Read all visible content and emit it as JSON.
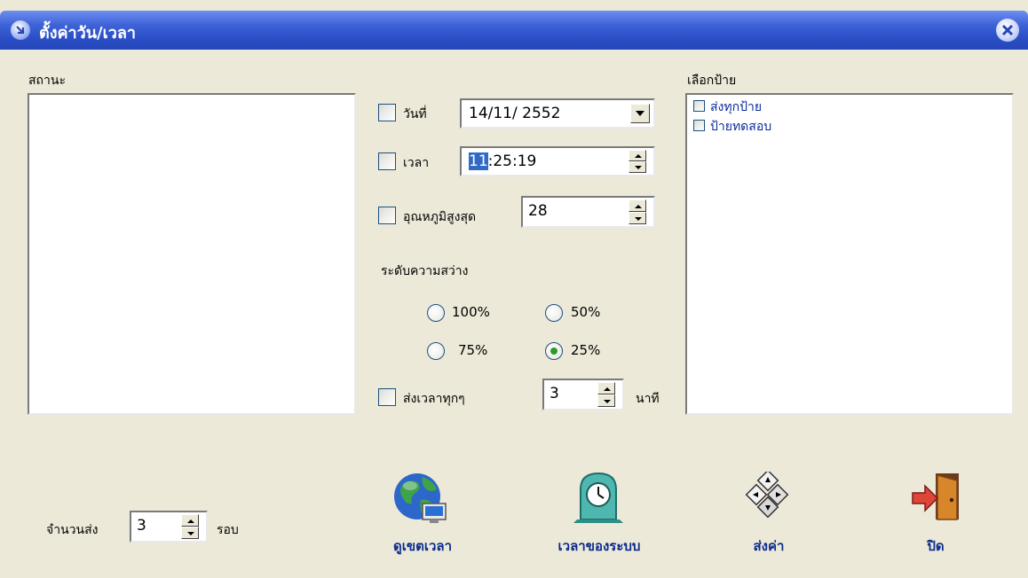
{
  "window": {
    "title": "ตั้งค่าวัน/เวลา"
  },
  "status": {
    "label": "สถานะ"
  },
  "date": {
    "label": "วันที่",
    "value": "14/11/ 2552"
  },
  "time": {
    "label": "เวลา",
    "value_highlight": "11",
    "value_rest": ":25:19"
  },
  "max_temp": {
    "label": "อุณหภูมิสูงสุด",
    "value": "28"
  },
  "brightness": {
    "label": "ระดับความสว่าง",
    "options": [
      "100%",
      "50%",
      "75%",
      "25%"
    ],
    "selected": "25%"
  },
  "send_time": {
    "label": "ส่งเวลาทุกๆ",
    "value": "3",
    "unit": "นาที"
  },
  "sign_select": {
    "label": "เลือกป้าย",
    "items": [
      "ส่งทุกป้าย",
      "ป้ายทดสอบ"
    ]
  },
  "send_count": {
    "label": "จำนวนส่ง",
    "value": "3",
    "unit": "รอบ"
  },
  "actions": {
    "world_time": "ดูเขตเวลา",
    "system_time": "เวลาของระบบ",
    "send": "ส่งค่า",
    "close": "ปิด"
  }
}
